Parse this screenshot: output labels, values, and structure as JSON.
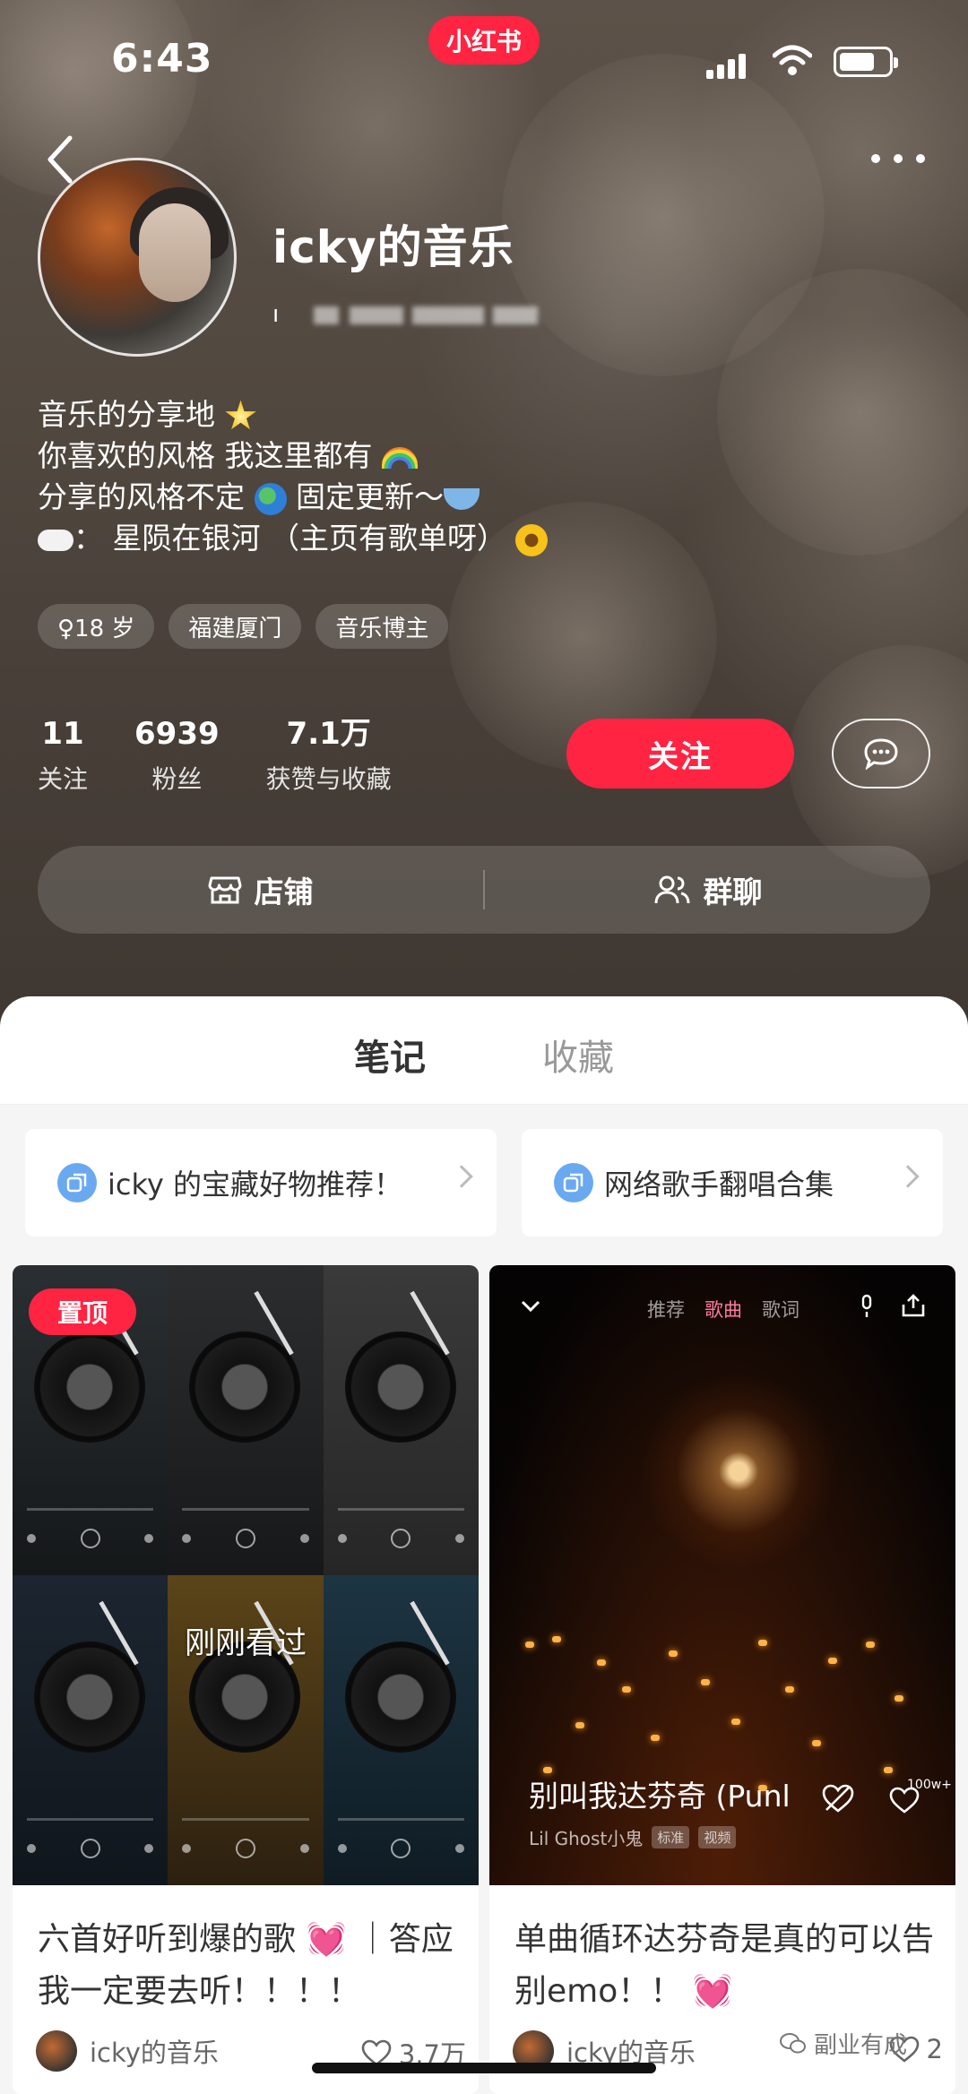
{
  "status_bar": {
    "time": "6:43",
    "app_name": "小红书"
  },
  "profile": {
    "username": "icky的音乐",
    "user_id_prefix": "ı",
    "bio": [
      "音乐的分享地",
      "你喜欢的风格 我这里都有",
      "分享的风格不定",
      "固定更新～",
      "：  星陨在银河  （主页有歌单呀）"
    ],
    "tags": [
      {
        "label": "♀18 岁"
      },
      {
        "label": "福建厦门"
      },
      {
        "label": "音乐博主"
      }
    ],
    "stats": [
      {
        "value": "11",
        "label": "关注"
      },
      {
        "value": "6939",
        "label": "粉丝"
      },
      {
        "value": "7.1万",
        "label": "获赞与收藏"
      }
    ],
    "follow_label": "关注",
    "shop_label": "店铺",
    "group_chat_label": "群聊"
  },
  "tabs": [
    {
      "label": "笔记",
      "active": true
    },
    {
      "label": "收藏",
      "active": false
    }
  ],
  "collections": [
    {
      "label": "icky 的宝藏好物推荐！"
    },
    {
      "label": "网络歌手翻唱合集"
    }
  ],
  "notes": [
    {
      "badge": "置顶",
      "overlay": "刚刚看过",
      "title": "六首好听到爆的歌 💓 ｜答应我一定要去听！！！！",
      "author": "icky的音乐",
      "likes": "3.7万"
    },
    {
      "video_tabs": [
        "推荐",
        "歌曲",
        "歌词"
      ],
      "song": "别叫我达芬奇 (Punl",
      "artist": "Lil Ghost小鬼",
      "artist_tags": [
        "标准",
        "视频"
      ],
      "like_count_overlay": "100w+",
      "title": "单曲循环达芬奇是真的可以告别emo！！ 💓",
      "author": "icky的音乐",
      "likes": "2"
    }
  ],
  "watermark": "副业有成",
  "colors": {
    "accent": "#ff2442",
    "header_bg": "#4f463e",
    "collection_icon": "#6aa9f0"
  }
}
